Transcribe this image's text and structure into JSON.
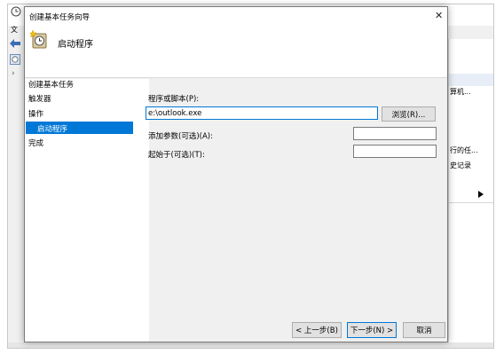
{
  "background_app": {
    "title_fragment": "文",
    "right_panel": {
      "items": [
        "算机...",
        "行的任...",
        "史记录"
      ]
    }
  },
  "dialog": {
    "title": "创建基本任务向导",
    "header_title": "启动程序",
    "sidebar": {
      "heading": "创建基本任务",
      "items": [
        "触发器",
        "操作",
        "启动程序",
        "完成"
      ]
    },
    "form": {
      "program_label": "程序或脚本(P):",
      "program_value": "e:\\outlook.exe",
      "browse_label": "浏览(R)...",
      "args_label": "添加参数(可选)(A):",
      "args_value": "",
      "start_label": "起始于(可选)(T):",
      "start_value": ""
    },
    "buttons": {
      "back": "< 上一步(B)",
      "next": "下一步(N) >",
      "cancel": "取消"
    },
    "close_glyph": "✕"
  },
  "colors": {
    "selection": "#0078d7",
    "dialog_bg": "#f0f0f0"
  }
}
